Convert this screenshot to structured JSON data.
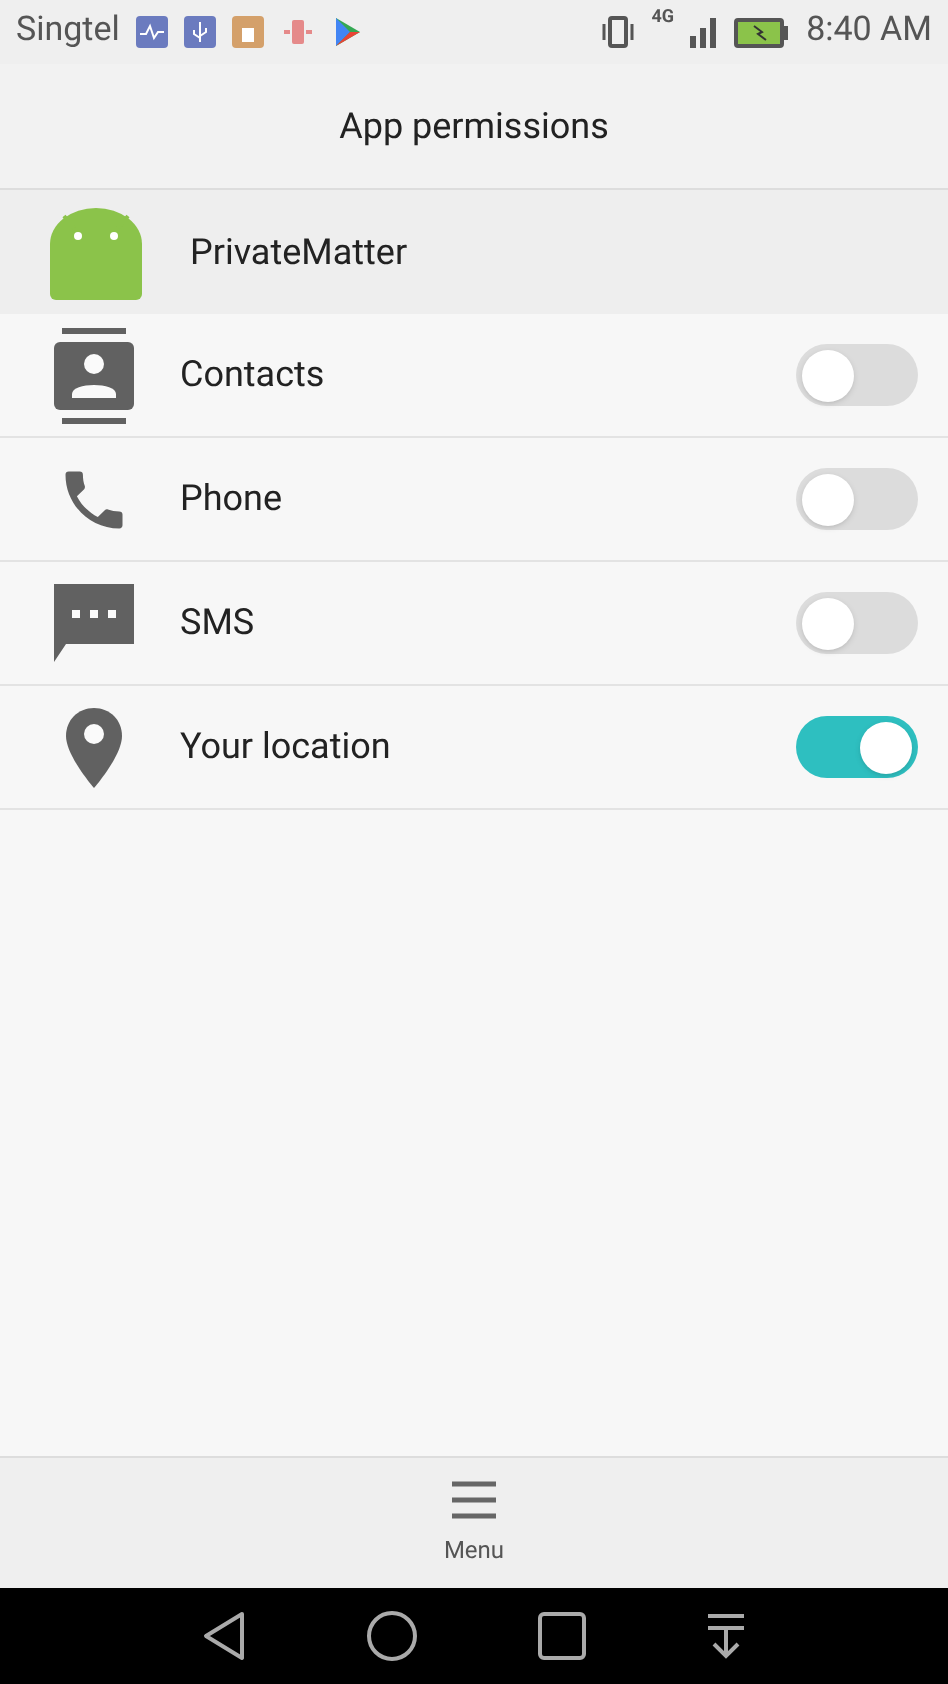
{
  "status_bar": {
    "carrier": "Singtel",
    "network": "4G",
    "time": "8:40 AM"
  },
  "header": {
    "title": "App permissions"
  },
  "app": {
    "name": "PrivateMatter"
  },
  "permissions": [
    {
      "label": "Contacts",
      "on": false
    },
    {
      "label": "Phone",
      "on": false
    },
    {
      "label": "SMS",
      "on": false
    },
    {
      "label": "Your location",
      "on": true
    }
  ],
  "bottom_bar": {
    "menu_label": "Menu"
  }
}
